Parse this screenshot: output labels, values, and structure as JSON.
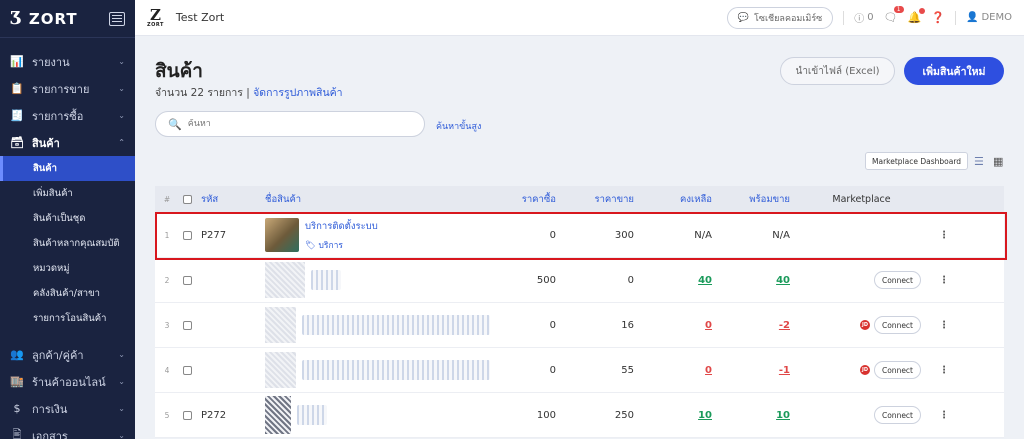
{
  "sidebar": {
    "brand": "ZORT",
    "items": [
      {
        "label": "รายงาน",
        "icon": "📊"
      },
      {
        "label": "รายการขาย",
        "icon": "📋"
      },
      {
        "label": "รายการซื้อ",
        "icon": "🧾"
      },
      {
        "label": "สินค้า",
        "icon": "🗃"
      }
    ],
    "subitems": [
      "สินค้า",
      "เพิ่มสินค้า",
      "สินค้าเป็นชุด",
      "สินค้าหลากคุณสมบัติ",
      "หมวดหมู่",
      "คลังสินค้า/สาขา",
      "รายการโอนสินค้า"
    ],
    "items_bottom": [
      {
        "label": "ลูกค้า/คู่ค้า",
        "icon": "👥"
      },
      {
        "label": "ร้านค้าออนไลน์",
        "icon": "🏬"
      },
      {
        "label": "การเงิน",
        "icon": "$"
      },
      {
        "label": "เอกสาร",
        "icon": "🖹"
      }
    ]
  },
  "topbar": {
    "logo": "Z",
    "logo_sub": "ZORT",
    "store": "Test Zort",
    "social_btn": "โซเชียลคอมเมิร์ซ",
    "credit": "0",
    "msg_badge": "1",
    "user": "DEMO"
  },
  "main": {
    "title": "สินค้า",
    "count_text": "จำนวน 22 รายการ",
    "manage_images": "จัดการรูปภาพสินค้า",
    "import_btn": "นำเข้าไฟล์ (Excel)",
    "add_btn": "เพิ่มสินค้าใหม่",
    "search_placeholder": "ค้นหา",
    "advanced_search": "ค้นหาขั้นสูง",
    "marketplace_dashboard": "Marketplace Dashboard"
  },
  "table": {
    "headers": {
      "idx": "#",
      "code": "รหัส",
      "name": "ชื่อสินค้า",
      "buy": "ราคาซื้อ",
      "sell": "ราคาขาย",
      "stock": "คงเหลือ",
      "avail": "พร้อมขาย",
      "marketplace": "Marketplace"
    },
    "rows": [
      {
        "idx": "1",
        "code": "P277",
        "name": "บริการติดตั้งระบบ",
        "tag": "บริการ",
        "buy": "0",
        "sell": "300",
        "stock": "N/A",
        "avail": "N/A",
        "connect": ""
      },
      {
        "idx": "2",
        "code": "",
        "name": "",
        "tag": "",
        "buy": "500",
        "sell": "0",
        "stock": "40",
        "avail": "40",
        "connect": "Connect"
      },
      {
        "idx": "3",
        "code": "",
        "name": "",
        "tag": "",
        "buy": "0",
        "sell": "16",
        "stock": "0",
        "avail": "-2",
        "connect": "Connect"
      },
      {
        "idx": "4",
        "code": "",
        "name": "",
        "tag": "",
        "buy": "0",
        "sell": "55",
        "stock": "0",
        "avail": "-1",
        "connect": "Connect"
      },
      {
        "idx": "5",
        "code": "P272",
        "name": "",
        "tag": "",
        "buy": "100",
        "sell": "250",
        "stock": "10",
        "avail": "10",
        "connect": "Connect"
      }
    ],
    "jd_label": "JD"
  },
  "colors": {
    "sidebar": "#1a2340",
    "accent": "#2e4fe0",
    "positive": "#1a9a5a",
    "negative": "#e04848",
    "highlight": "#d8171e"
  }
}
